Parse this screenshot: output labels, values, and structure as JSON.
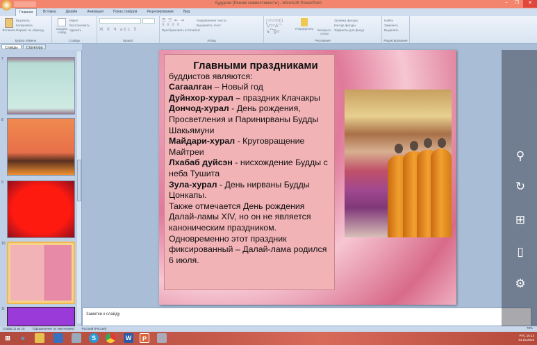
{
  "window": {
    "title": "буддизм [Режим совместимости] - Microsoft PowerPoint",
    "minimize": "–",
    "restore": "❐",
    "close": "✕"
  },
  "tabs": [
    "Главная",
    "Вставка",
    "Дизайн",
    "Анимация",
    "Показ слайдов",
    "Рецензирование",
    "Вид"
  ],
  "ribbon": {
    "clipboard": {
      "label": "Буфер обмена",
      "paste": "Вставить",
      "cut": "Вырезать",
      "copy": "Копировать",
      "format": "Формат по образцу"
    },
    "slides": {
      "label": "Слайды",
      "new": "Создать слайд",
      "layout": "Макет",
      "reset": "Восстановить",
      "delete": "Удалить"
    },
    "font": {
      "label": "Шрифт"
    },
    "paragraph": {
      "label": "Абзац",
      "direction": "Направление текста",
      "align": "Выровнять текст",
      "smartart": "Преобразовать в SmartArt"
    },
    "drawing": {
      "label": "Рисование",
      "arrange": "Упорядочить",
      "styles": "Экспресс-стили",
      "fill": "Заливка фигуры",
      "outline": "Контур фигуры",
      "effects": "Эффекты для фигур"
    },
    "editing": {
      "label": "Редактирование",
      "find": "Найти",
      "replace": "Заменить",
      "select": "Выделить"
    }
  },
  "pane_tabs": [
    "Слайды",
    "Структура"
  ],
  "thumb_numbers": [
    "7",
    "8",
    "9",
    "10",
    "11"
  ],
  "slide": {
    "heading": "Главными праздниками",
    "lines": [
      {
        "b": "",
        "t": "буддистов являются:"
      },
      {
        "b": "Сагаалган",
        "t": " – Новый год"
      },
      {
        "b": "Дуйнхор-хурал –",
        "t": " праздник Клачакры"
      },
      {
        "b": "Дончод-хурал",
        "t": " - День рождения, Просветления и Паринирваны Будды Шакьямуни"
      },
      {
        "b": "Майдари-хурал",
        "t": " - Круговращение Майтреи"
      },
      {
        "b": "Лхабаб дуйсэн",
        "t": " - нисхождение Будды с неба Тушита"
      },
      {
        "b": "Зула-хурал",
        "t": " - День нирваны Будды Цонкапы."
      },
      {
        "b": "",
        "t": "Также отмечается День рождения Далай-ламы XIV, но он не является каноническим праздником. Одновременно этот праздник фиксированный – Далай-лама родился 6 июля."
      }
    ]
  },
  "notes": {
    "placeholder": "Заметки к слайду"
  },
  "status": {
    "slide": "Слайд 11 из 15",
    "theme": "\"Оформление по умолчанию\"",
    "lang": "Русский (Россия)",
    "zoom": "78%"
  },
  "tray": {
    "lang": "РУС",
    "time": "16:14",
    "date": "01.03.2016"
  },
  "colors": {
    "titlebar": "#f3846e",
    "ribbon": "#dbe6f3",
    "selected": "#f2b650"
  }
}
